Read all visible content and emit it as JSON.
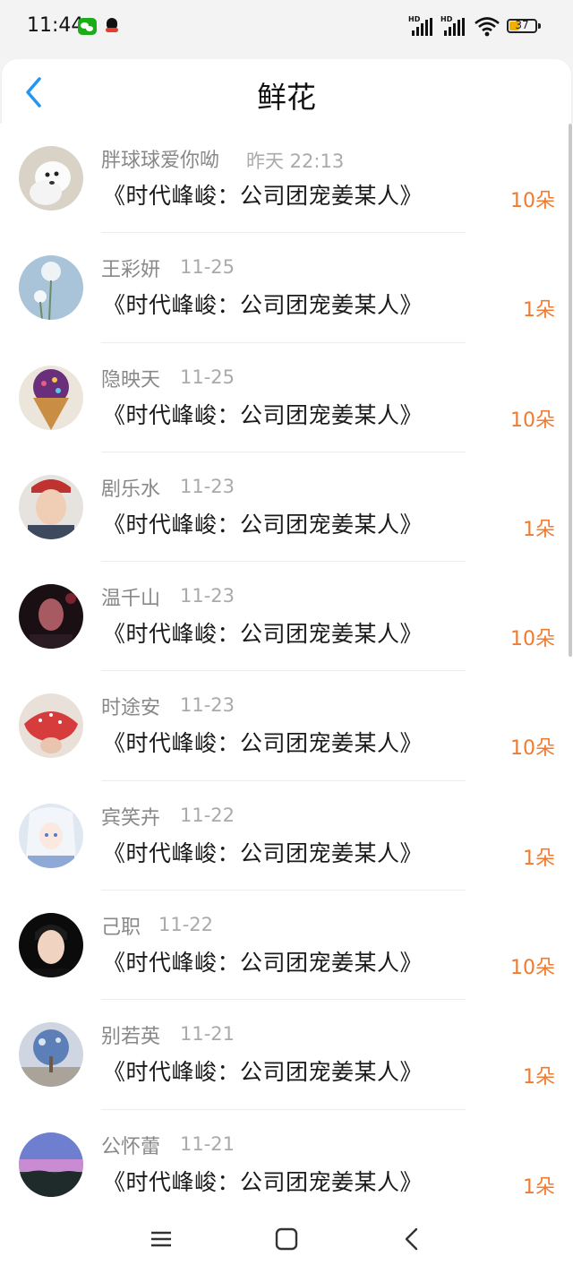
{
  "status_bar": {
    "time": "11:44",
    "signal_1_label": "HD",
    "signal_2_label": "HD",
    "battery_level": "37"
  },
  "header": {
    "title": "鲜花",
    "back_icon": "chevron-left-icon"
  },
  "colors": {
    "accent": "#f07a2e",
    "back_arrow": "#2196f3"
  },
  "items": [
    {
      "name": "胖球球爱你呦",
      "date": "昨天 22:13",
      "book": "《时代峰峻：公司团宠姜某人》",
      "count": "10朵"
    },
    {
      "name": "王彩妍",
      "date": "11-25",
      "book": "《时代峰峻：公司团宠姜某人》",
      "count": "1朵"
    },
    {
      "name": "隐映天",
      "date": "11-25",
      "book": "《时代峰峻：公司团宠姜某人》",
      "count": "10朵"
    },
    {
      "name": "剧乐水",
      "date": "11-23",
      "book": "《时代峰峻：公司团宠姜某人》",
      "count": "1朵"
    },
    {
      "name": "温千山",
      "date": "11-23",
      "book": "《时代峰峻：公司团宠姜某人》",
      "count": "10朵"
    },
    {
      "name": "时途安",
      "date": "11-23",
      "book": "《时代峰峻：公司团宠姜某人》",
      "count": "10朵"
    },
    {
      "name": "宾笑卉",
      "date": "11-22",
      "book": "《时代峰峻：公司团宠姜某人》",
      "count": "1朵"
    },
    {
      "name": "己职",
      "date": "11-22",
      "book": "《时代峰峻：公司团宠姜某人》",
      "count": "10朵"
    },
    {
      "name": "别若英",
      "date": "11-21",
      "book": "《时代峰峻：公司团宠姜某人》",
      "count": "1朵"
    },
    {
      "name": "公怀蕾",
      "date": "11-21",
      "book": "《时代峰峻：公司团宠姜某人》",
      "count": "1朵"
    }
  ],
  "nav_bar": {
    "menu_icon": "menu-icon",
    "home_icon": "home-square-icon",
    "back_icon": "back-triangle-icon"
  }
}
